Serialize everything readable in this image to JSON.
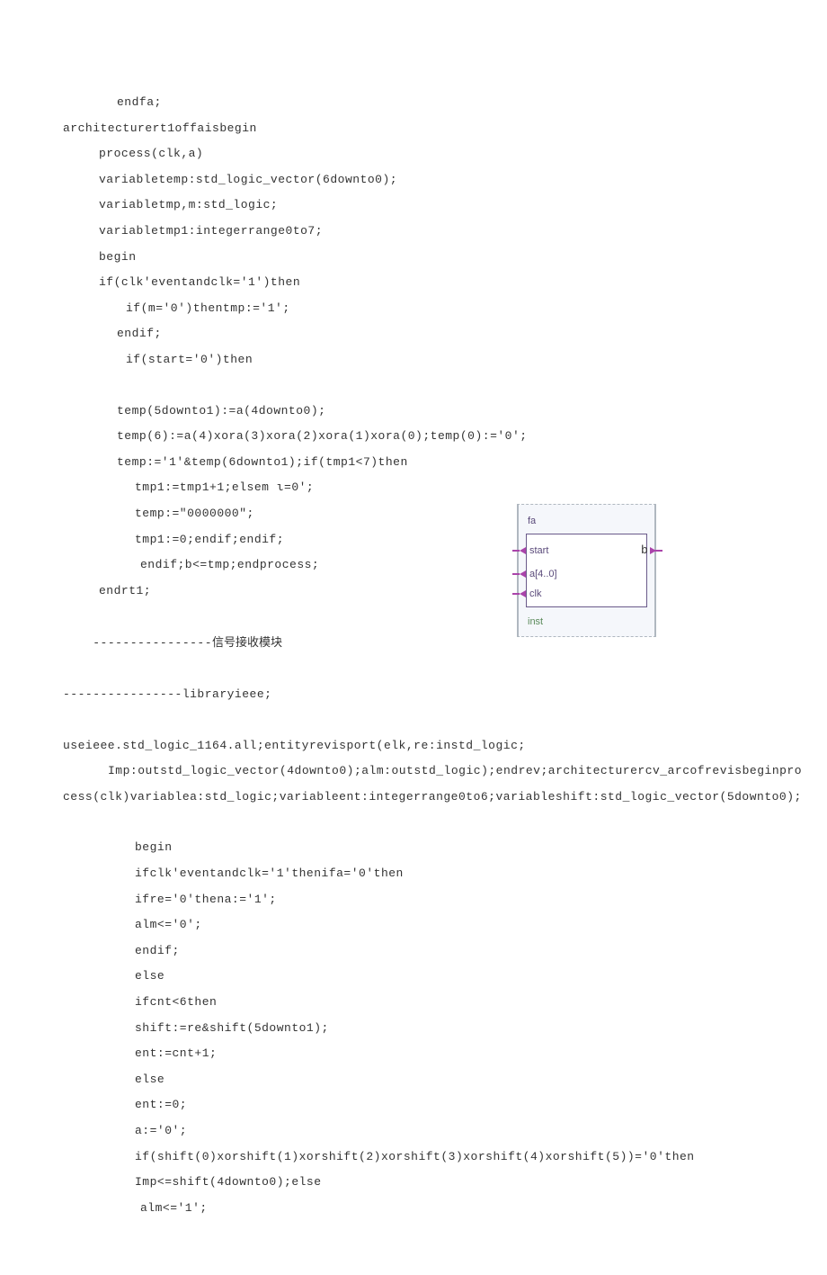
{
  "lines": {
    "l01": "endfa;",
    "l02": "architecturert1offaisbegin",
    "l03": "process(clk,a)",
    "l04": "variabletemp:std_logic_vector(6downto0);",
    "l05": "variabletmp,m:std_logic;",
    "l06": "variabletmp1:integerrange0to7;",
    "l07": "begin",
    "l08": "if(clk'eventandclk='1')then",
    "l09": "if(m='0')thentmp:='1';",
    "l10": "endif;",
    "l11": "if(start='0')then",
    "l12": "temp(5downto1):=a(4downto0);",
    "l13": "temp(6):=a(4)xora(3)xora(2)xora(1)xora(0);temp(0):='0';",
    "l14": "temp:='1'&temp(6downto1);if(tmp1<7)then",
    "l15": "tmp1:=tmp1+1;elsem ι=0';",
    "l16": "temp:=\"0000000\";",
    "l17": "tmp1:=0;endif;endif;",
    "l18": "endif;b<=tmp;endprocess;",
    "l19": "endrt1;",
    "l20_dashes": "----------------",
    "l20_cn": "信号接收模块",
    "l21": "----------------libraryieee;",
    "l22": "useieee.std_logic_1164.all;entityrevisport(elk,re:instd_logic;",
    "l23": "Imp:outstd_logic_vector(4downto0);alm:outstd_logic);endrev;architecturercv_arcofrevisbeginpro",
    "l24": "cess(clk)variablea:std_logic;variableent:integerrange0to6;variableshift:std_logic_vector(5downto0);",
    "l25": "begin",
    "l26": "ifclk'eventandclk='1'thenifa='0'then",
    "l27": "ifre='0'thena:='1';",
    "l28": "alm<='0';",
    "l29": "endif;",
    "l30": "else",
    "l31": "ifcnt<6then",
    "l32": "shift:=re&shift(5downto1);",
    "l33": "ent:=cnt+1;",
    "l34": "else",
    "l35": "ent:=0;",
    "l36": "a:='0';",
    "l37": "if(shift(0)xorshift(1)xorshift(2)xorshift(3)xorshift(4)xorshift(5))='0'then",
    "l38": "Imp<=shift(4downto0);else",
    "l39": "alm<='1';"
  },
  "diagram": {
    "title": "fa",
    "ports_left": [
      "start",
      "a[4..0]",
      "clk"
    ],
    "port_right": "b",
    "inst": "inst"
  }
}
